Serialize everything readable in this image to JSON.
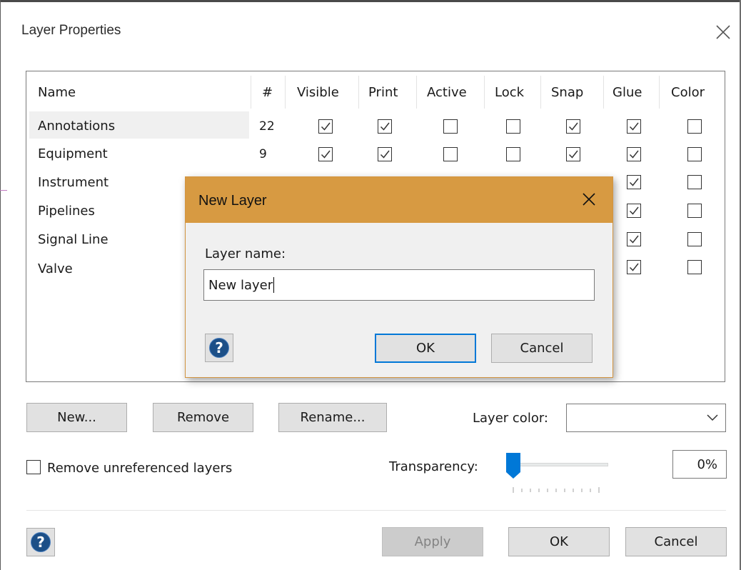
{
  "dialog": {
    "title": "Layer Properties",
    "close_icon": "close-icon"
  },
  "layers_table": {
    "columns": [
      "Name",
      "#",
      "Visible",
      "Print",
      "Active",
      "Lock",
      "Snap",
      "Glue",
      "Color"
    ],
    "rows": [
      {
        "name": "Annotations",
        "count": "22",
        "visible": true,
        "print": true,
        "active": false,
        "lock": false,
        "snap": true,
        "glue": true,
        "color": false,
        "selected": true
      },
      {
        "name": "Equipment",
        "count": "9",
        "visible": true,
        "print": true,
        "active": false,
        "lock": false,
        "snap": true,
        "glue": true,
        "color": false
      },
      {
        "name": "Instrument",
        "count": "",
        "visible": null,
        "print": null,
        "active": null,
        "lock": null,
        "snap": null,
        "glue": true,
        "color": false
      },
      {
        "name": "Pipelines",
        "count": "",
        "visible": null,
        "print": null,
        "active": null,
        "lock": null,
        "snap": null,
        "glue": true,
        "color": false
      },
      {
        "name": "Signal Line",
        "count": "",
        "visible": null,
        "print": null,
        "active": null,
        "lock": null,
        "snap": null,
        "glue": true,
        "color": false
      },
      {
        "name": "Valve",
        "count": "",
        "visible": null,
        "print": null,
        "active": null,
        "lock": null,
        "snap": null,
        "glue": true,
        "color": false
      }
    ]
  },
  "actions": {
    "new_label": "New...",
    "remove_label": "Remove",
    "rename_label": "Rename...",
    "layer_color_label": "Layer color:",
    "layer_color_value": ""
  },
  "options": {
    "remove_unreferenced_label": "Remove unreferenced layers",
    "remove_unreferenced_checked": false,
    "transparency_label": "Transparency:",
    "transparency_value": "0%",
    "transparency_fraction": 0
  },
  "footer": {
    "help_icon": "help-icon",
    "apply_label": "Apply",
    "ok_label": "OK",
    "cancel_label": "Cancel"
  },
  "new_layer_dialog": {
    "title": "New Layer",
    "close_icon": "close-icon",
    "field_label": "Layer name:",
    "field_value": "New layer",
    "help_icon": "help-icon",
    "ok_label": "OK",
    "cancel_label": "Cancel",
    "accent_color": "#d79a42"
  }
}
